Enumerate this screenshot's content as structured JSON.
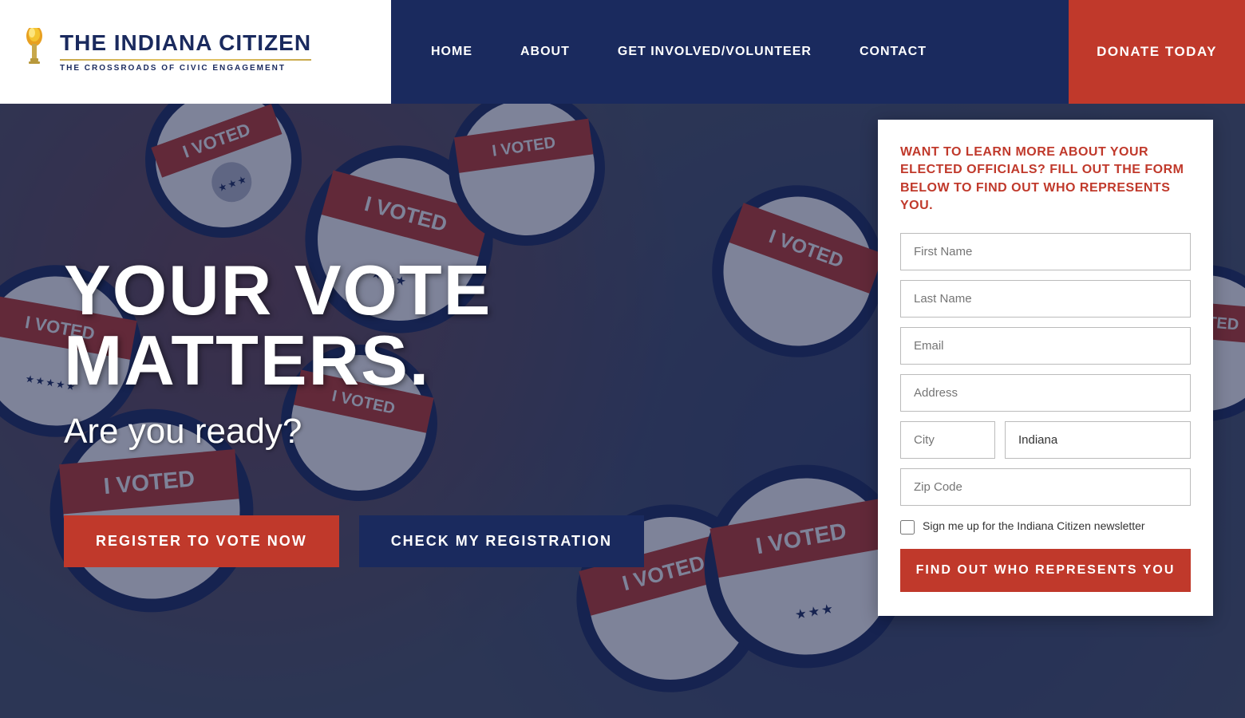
{
  "header": {
    "logo": {
      "title": "THE INDIANA CITIZEN",
      "subtitle": "THE CROSSROADS OF CIVIC ENGAGEMENT"
    },
    "nav": {
      "items": [
        {
          "label": "HOME",
          "id": "home"
        },
        {
          "label": "ABOUT",
          "id": "about"
        },
        {
          "label": "GET INVOLVED/VOLUNTEER",
          "id": "get-involved"
        },
        {
          "label": "CONTACT",
          "id": "contact"
        }
      ],
      "donate_label": "DONATE TODAY"
    }
  },
  "hero": {
    "main_text": "YOUR VOTE MATTERS.",
    "sub_text": "Are you ready?",
    "btn_register": "REGISTER TO VOTE NOW",
    "btn_check": "CHECK MY REGISTRATION"
  },
  "form": {
    "heading": "WANT TO LEARN MORE ABOUT YOUR ELECTED OFFICIALS? FILL OUT THE FORM BELOW TO FIND OUT WHO REPRESENTS YOU.",
    "first_name_placeholder": "First Name",
    "last_name_placeholder": "Last Name",
    "email_placeholder": "Email",
    "address_placeholder": "Address",
    "city_placeholder": "City",
    "state_value": "Indiana",
    "zip_placeholder": "Zip Code",
    "newsletter_label": "Sign me up for the Indiana Citizen newsletter",
    "submit_label": "FIND OUT WHO REPRESENTS YOU"
  }
}
